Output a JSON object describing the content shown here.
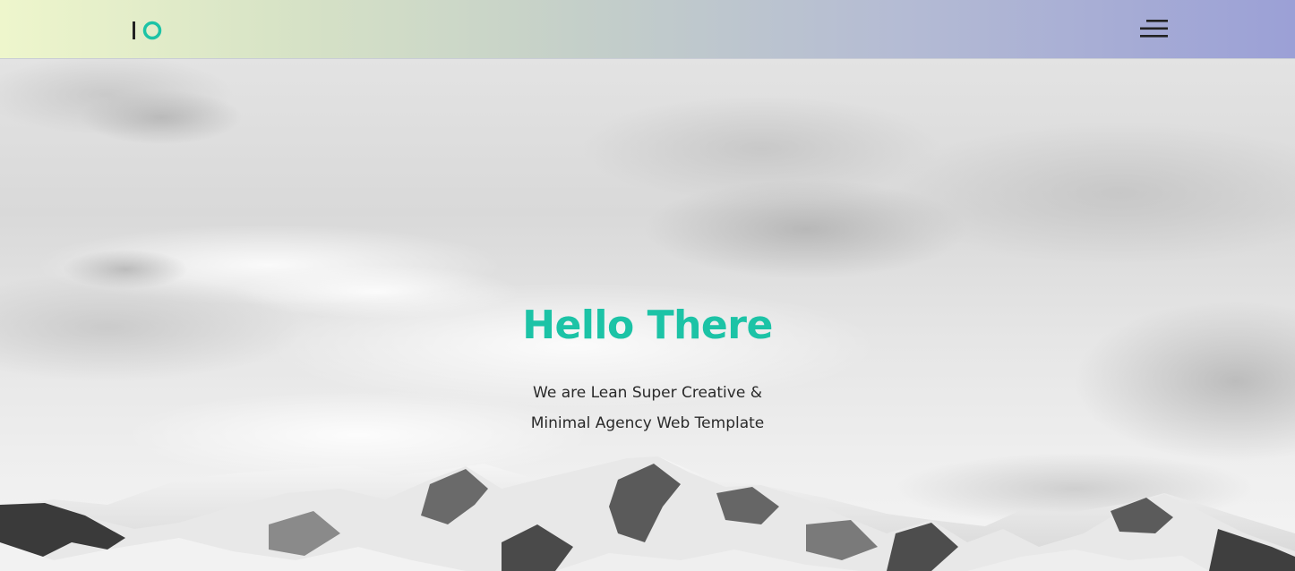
{
  "header": {
    "logo": {
      "icon": "io-logo-icon",
      "colors": {
        "bar": "#222222",
        "ring": "#1cc3a6"
      }
    },
    "menu": {
      "icon": "hamburger-menu-icon"
    },
    "gradient": [
      "#eef6cc",
      "#9ba0d6"
    ]
  },
  "hero": {
    "background": "snowy-mountains-under-cloudy-sky",
    "title": "Hello There",
    "subtitle_line1": "We are Lean Super Creative &",
    "subtitle_line2": "Minimal Agency Web Template"
  },
  "colors": {
    "accent": "#1cc3a6",
    "text": "#2a2a2a"
  }
}
